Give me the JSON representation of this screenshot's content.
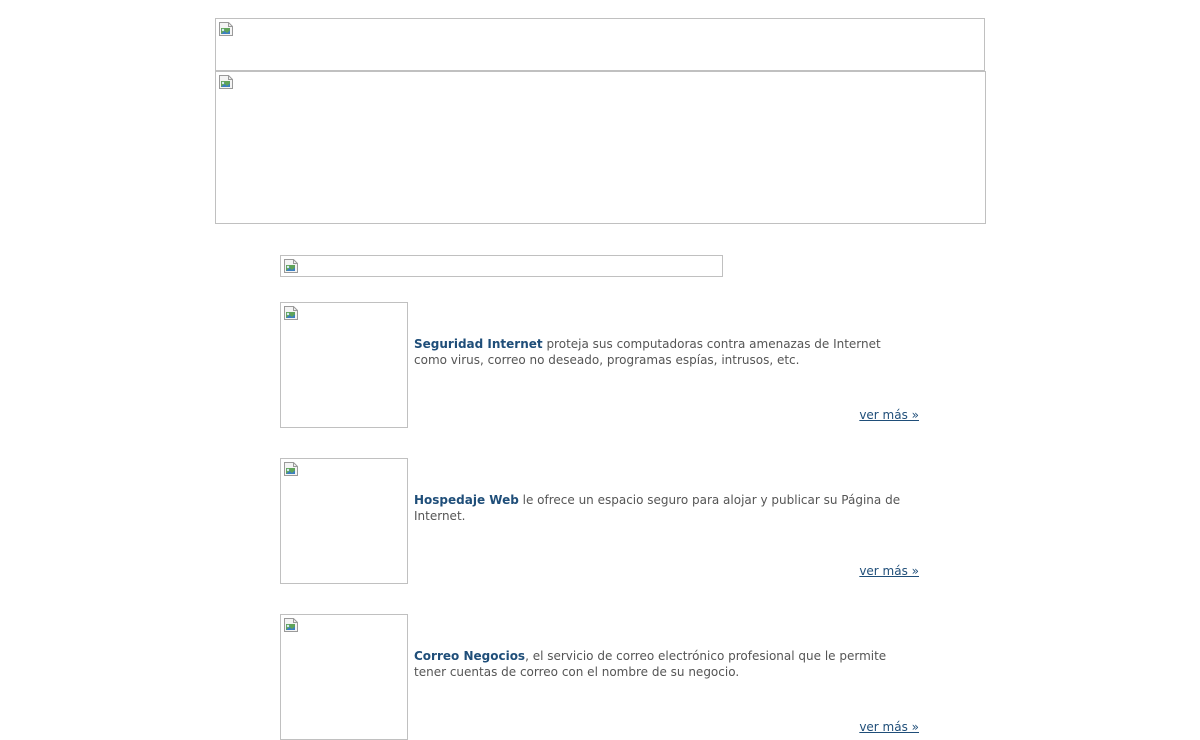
{
  "products": [
    {
      "name": "Seguridad Internet",
      "description": " proteja sus computadoras contra amenazas de Internet como virus, correo no deseado, programas espías, intrusos, etc.",
      "more_label": "ver más »"
    },
    {
      "name": "Hospedaje Web",
      "description": " le ofrece un espacio seguro para alojar y publicar su Página de Internet.",
      "more_label": "ver más »"
    },
    {
      "name": "Correo Negocios",
      "description": ", el servicio de correo electrónico profesional que le permite tener cuentas de correo con el nombre de su negocio.",
      "more_label": "ver más »"
    }
  ],
  "icons": {
    "broken_image": "broken-image-icon"
  }
}
